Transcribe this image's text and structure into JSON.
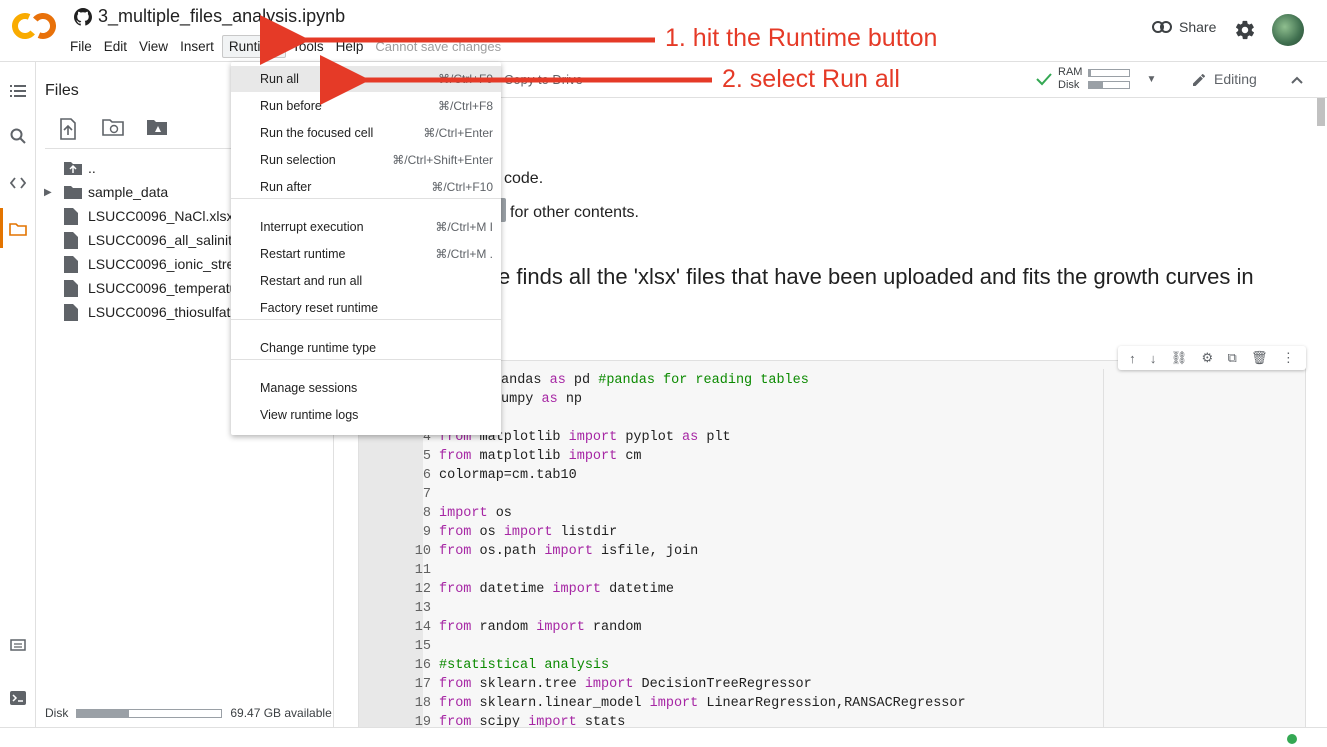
{
  "header": {
    "notebook_title": "3_multiple_files_analysis.ipynb",
    "menu": [
      "File",
      "Edit",
      "View",
      "Insert",
      "Runtime",
      "Tools",
      "Help"
    ],
    "status": "Cannot save changes",
    "share_label": "Share"
  },
  "toolbar": {
    "copy_to_drive": "Copy to Drive",
    "ram_label": "RAM",
    "disk_label": "Disk",
    "ram_fraction": 0.05,
    "disk_fraction": 0.35,
    "editing_label": "Editing"
  },
  "files_panel": {
    "title": "Files",
    "items": [
      {
        "name": "..",
        "type": "parent"
      },
      {
        "name": "sample_data",
        "type": "folder"
      },
      {
        "name": "LSUCC0096_NaCl.xlsx",
        "type": "file"
      },
      {
        "name": "LSUCC0096_all_salinity",
        "type": "file"
      },
      {
        "name": "LSUCC0096_ionic_stre",
        "type": "file"
      },
      {
        "name": "LSUCC0096_temperatu",
        "type": "file"
      },
      {
        "name": "LSUCC0096_thiosulfate",
        "type": "file"
      }
    ],
    "disk_label": "Disk",
    "disk_available": "69.47 GB available",
    "disk_fraction": 0.36
  },
  "runtime_menu": {
    "items": [
      {
        "label": "Run all",
        "shortcut": "⌘/Ctrl+F9"
      },
      {
        "label": "Run before",
        "shortcut": "⌘/Ctrl+F8"
      },
      {
        "label": "Run the focused cell",
        "shortcut": "⌘/Ctrl+Enter"
      },
      {
        "label": "Run selection",
        "shortcut": "⌘/Ctrl+Shift+Enter"
      },
      {
        "label": "Run after",
        "shortcut": "⌘/Ctrl+F10"
      },
      {
        "label": "Interrupt execution",
        "shortcut": "⌘/Ctrl+M I"
      },
      {
        "label": "Restart runtime",
        "shortcut": "⌘/Ctrl+M ."
      },
      {
        "label": "Restart and run all",
        "shortcut": ""
      },
      {
        "label": "Factory reset runtime",
        "shortcut": ""
      },
      {
        "label": "Change runtime type",
        "shortcut": ""
      },
      {
        "label": "Manage sessions",
        "shortcut": ""
      },
      {
        "label": "View runtime logs",
        "shortcut": ""
      }
    ]
  },
  "content": {
    "text_line_1": "code.",
    "text_line_2": "for other contents.",
    "heading": "e finds all the 'xlsx' files that have been uploaded and fits the growth curves in"
  },
  "code_lines": [
    {
      "n": "",
      "segments": [
        {
          "t": "andas ",
          "c": ""
        },
        {
          "t": "as",
          "c": "kw"
        },
        {
          "t": " pd ",
          "c": ""
        },
        {
          "t": "#pandas for reading tables",
          "c": "cm"
        }
      ]
    },
    {
      "n": "",
      "segments": [
        {
          "t": "umpy ",
          "c": ""
        },
        {
          "t": "as",
          "c": "kw"
        },
        {
          "t": " np",
          "c": ""
        }
      ]
    },
    {
      "n": "",
      "segments": []
    },
    {
      "n": "4",
      "segments": [
        {
          "t": "from",
          "c": "kw"
        },
        {
          "t": " matplotlib ",
          "c": ""
        },
        {
          "t": "import",
          "c": "kw"
        },
        {
          "t": " pyplot ",
          "c": ""
        },
        {
          "t": "as",
          "c": "kw"
        },
        {
          "t": " plt",
          "c": ""
        }
      ]
    },
    {
      "n": "5",
      "segments": [
        {
          "t": "from",
          "c": "kw"
        },
        {
          "t": " matplotlib ",
          "c": ""
        },
        {
          "t": "import",
          "c": "kw"
        },
        {
          "t": " cm",
          "c": ""
        }
      ]
    },
    {
      "n": "6",
      "segments": [
        {
          "t": "colormap=cm.tab10",
          "c": ""
        }
      ]
    },
    {
      "n": "7",
      "segments": []
    },
    {
      "n": "8",
      "segments": [
        {
          "t": "import",
          "c": "kw"
        },
        {
          "t": " os",
          "c": ""
        }
      ]
    },
    {
      "n": "9",
      "segments": [
        {
          "t": "from",
          "c": "kw"
        },
        {
          "t": " os ",
          "c": ""
        },
        {
          "t": "import",
          "c": "kw"
        },
        {
          "t": " listdir",
          "c": ""
        }
      ]
    },
    {
      "n": "10",
      "segments": [
        {
          "t": "from",
          "c": "kw"
        },
        {
          "t": " os.path ",
          "c": ""
        },
        {
          "t": "import",
          "c": "kw"
        },
        {
          "t": " isfile, join",
          "c": ""
        }
      ]
    },
    {
      "n": "11",
      "segments": []
    },
    {
      "n": "12",
      "segments": [
        {
          "t": "from",
          "c": "kw"
        },
        {
          "t": " datetime ",
          "c": ""
        },
        {
          "t": "import",
          "c": "kw"
        },
        {
          "t": " datetime",
          "c": ""
        }
      ]
    },
    {
      "n": "13",
      "segments": []
    },
    {
      "n": "14",
      "segments": [
        {
          "t": "from",
          "c": "kw"
        },
        {
          "t": " random ",
          "c": ""
        },
        {
          "t": "import",
          "c": "kw"
        },
        {
          "t": " random",
          "c": ""
        }
      ]
    },
    {
      "n": "15",
      "segments": []
    },
    {
      "n": "16",
      "segments": [
        {
          "t": "#statistical analysis",
          "c": "cm"
        }
      ]
    },
    {
      "n": "17",
      "segments": [
        {
          "t": "from",
          "c": "kw"
        },
        {
          "t": " sklearn.tree ",
          "c": ""
        },
        {
          "t": "import",
          "c": "kw"
        },
        {
          "t": " DecisionTreeRegressor",
          "c": ""
        }
      ]
    },
    {
      "n": "18",
      "segments": [
        {
          "t": "from",
          "c": "kw"
        },
        {
          "t": " sklearn.linear_model ",
          "c": ""
        },
        {
          "t": "import",
          "c": "kw"
        },
        {
          "t": " LinearRegression,RANSACRegressor",
          "c": ""
        }
      ]
    },
    {
      "n": "19",
      "segments": [
        {
          "t": "from",
          "c": "kw"
        },
        {
          "t": " scipy ",
          "c": ""
        },
        {
          "t": "import",
          "c": "kw"
        },
        {
          "t": " stats",
          "c": ""
        }
      ]
    }
  ],
  "annotations": {
    "step1": "1. hit the Runtime button",
    "step2": "2. select Run all",
    "arrow_color": "#e53a27"
  },
  "icons": {
    "logo": "colab-logo-icon",
    "github": "github-icon",
    "share": "link-icon",
    "settings": "gear-icon",
    "ram_ok": "check-icon",
    "editing": "pencil-icon",
    "collapse": "chevron-up-icon"
  }
}
